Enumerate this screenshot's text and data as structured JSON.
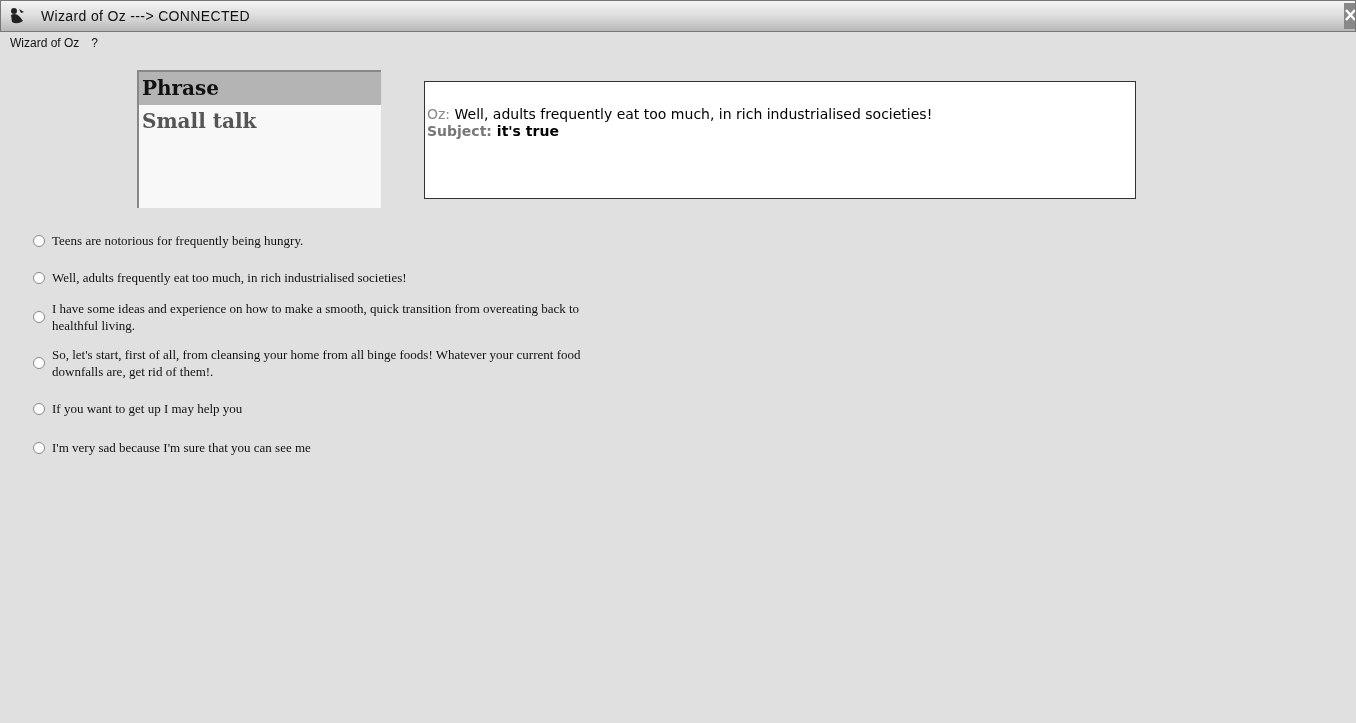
{
  "window": {
    "title": "Wizard of Oz ---> CONNECTED"
  },
  "menu": [
    "Wizard of Oz",
    "?"
  ],
  "category_list": [
    {
      "label": "Phrase",
      "selected": true
    },
    {
      "label": "Small talk",
      "selected": false
    }
  ],
  "transcript": [
    {
      "speaker": "Oz:",
      "text": "Well, adults frequently eat too much, in rich industrialised societies!",
      "kind": "plain"
    },
    {
      "speaker": "Subject:",
      "text": "it's true",
      "kind": "bold"
    }
  ],
  "phrases": [
    {
      "text": "Teens are notorious for frequently being hungry.",
      "selected": false
    },
    {
      "text": "Well, adults frequently eat too much, in rich industrialised societies!",
      "selected": false
    },
    {
      "text": "I have some ideas and experience on how to make a smooth, quick transition from overeating back to healthful living.",
      "selected": false
    },
    {
      "text": "So, let's start, first of all, from cleansing your home from all binge foods! Whatever your current food downfalls are, get rid of them!.",
      "selected": false
    },
    {
      "text": "If you want to get up I may help you",
      "selected": false
    },
    {
      "text": "I'm very sad because I'm sure that you can see me",
      "selected": false
    }
  ]
}
